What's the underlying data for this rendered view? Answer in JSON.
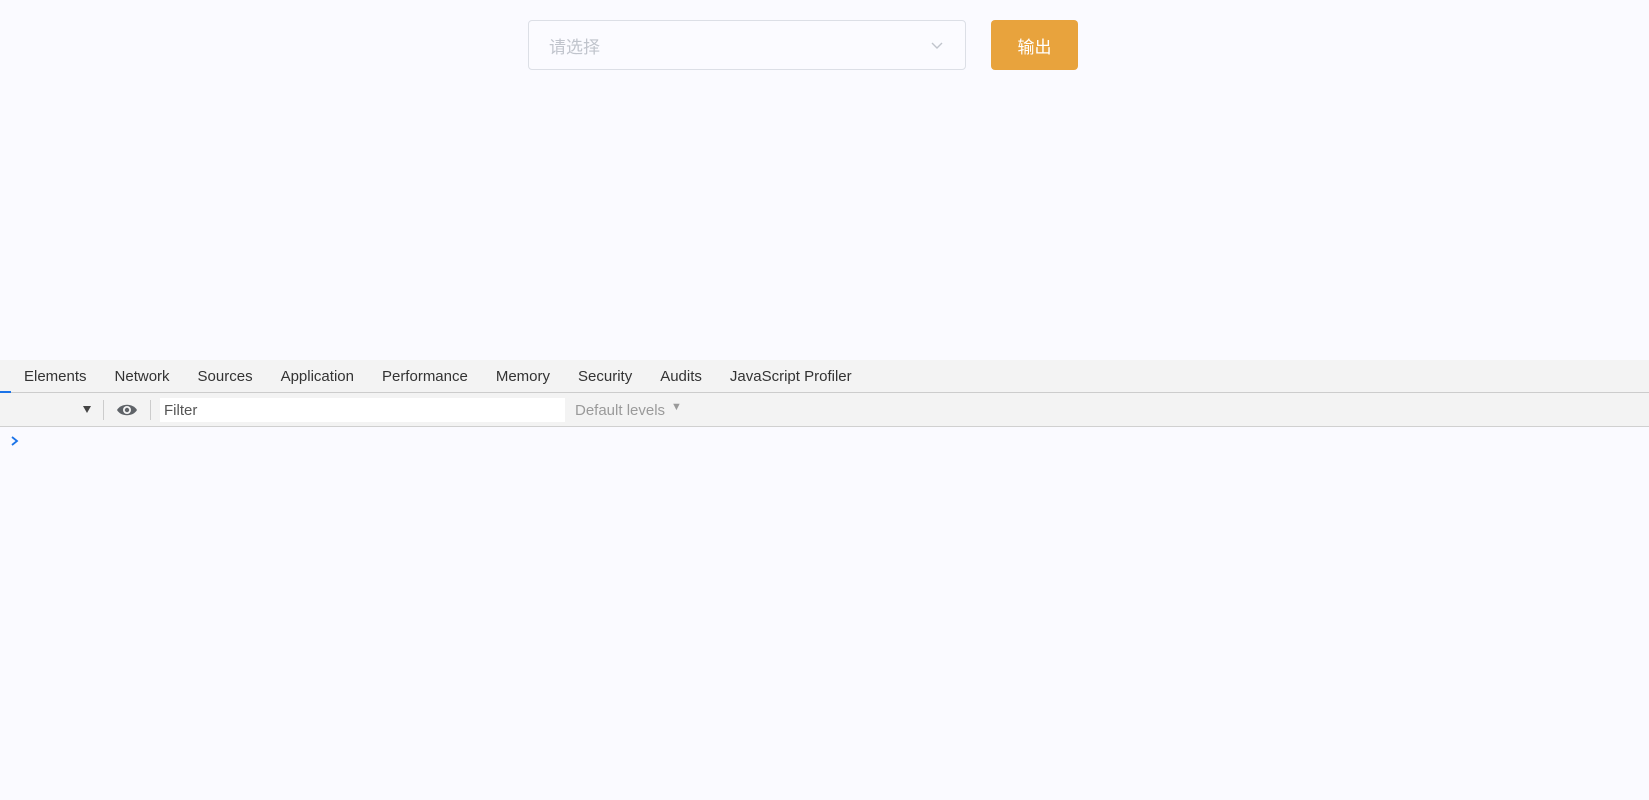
{
  "app": {
    "select": {
      "placeholder": "请选择",
      "arrow_icon": "chevron-down-icon"
    },
    "output_button": {
      "label": "输出",
      "color": "#e8a33d"
    }
  },
  "devtools": {
    "tabs": [
      {
        "label": "Elements"
      },
      {
        "label": "Network"
      },
      {
        "label": "Sources"
      },
      {
        "label": "Application"
      },
      {
        "label": "Performance"
      },
      {
        "label": "Memory"
      },
      {
        "label": "Security"
      },
      {
        "label": "Audits"
      },
      {
        "label": "JavaScript Profiler"
      }
    ],
    "toolbar": {
      "filter_placeholder": "Filter",
      "levels_label": "Default levels"
    },
    "console": {
      "prompt_icon": "chevron-right-icon",
      "prompt_color": "#1a73e8"
    }
  }
}
